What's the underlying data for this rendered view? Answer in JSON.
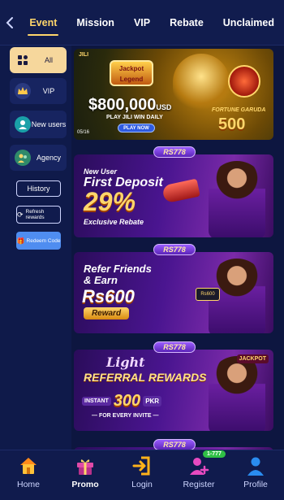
{
  "tabs": [
    {
      "label": "Event",
      "active": true
    },
    {
      "label": "Mission"
    },
    {
      "label": "VIP"
    },
    {
      "label": "Rebate"
    },
    {
      "label": "Unclaimed"
    }
  ],
  "sidebar": {
    "items": [
      {
        "label": "All",
        "icon": "grid-icon",
        "active": true
      },
      {
        "label": "VIP",
        "icon": "crown-icon"
      },
      {
        "label": "New users",
        "icon": "new-user-icon"
      },
      {
        "label": "Agency",
        "icon": "agency-icon"
      }
    ],
    "history_label": "History",
    "refresh_label": "Refresh rewards",
    "redeem_label": "Redeem Code"
  },
  "banners": {
    "b1": {
      "jackpot_label": "Jackpot Legend",
      "amount": "$800,000",
      "amount_unit": "USD",
      "subtitle": "PLAY JILI WIN DAILY",
      "cta": "PLAY NOW",
      "date": "05/16",
      "game_title": "FORTUNE GARUDA",
      "game_number": "500",
      "brand": "JILI"
    },
    "tag": "RS778",
    "b2": {
      "line1": "New User",
      "line2": "First Deposit",
      "percent": "29%",
      "line3": "Exclusive Rebate"
    },
    "b3": {
      "line1": "Refer Friends",
      "line2": "& Earn",
      "amount": "Rs600",
      "reward": "Reward",
      "card": "Rs600"
    },
    "b4": {
      "light": "Light",
      "title": "REFERRAL REWARDS",
      "instant": "INSTANT",
      "amount": "300",
      "currency": "PKR",
      "footer": "— FOR EVERY INVITE —",
      "jackpot": "JACKPOT"
    }
  },
  "bottomnav": [
    {
      "label": "Home",
      "icon": "home-icon"
    },
    {
      "label": "Promo",
      "icon": "gift-icon",
      "active": true
    },
    {
      "label": "Login",
      "icon": "login-icon"
    },
    {
      "label": "Register",
      "icon": "register-icon",
      "badge": "1-777"
    },
    {
      "label": "Profile",
      "icon": "profile-icon"
    }
  ],
  "colors": {
    "background": "#0d1640",
    "accent": "#ffd66b",
    "sidebar_active": "#f6d79c",
    "redeem": "#4f8df0",
    "badge": "#2fbf45"
  }
}
